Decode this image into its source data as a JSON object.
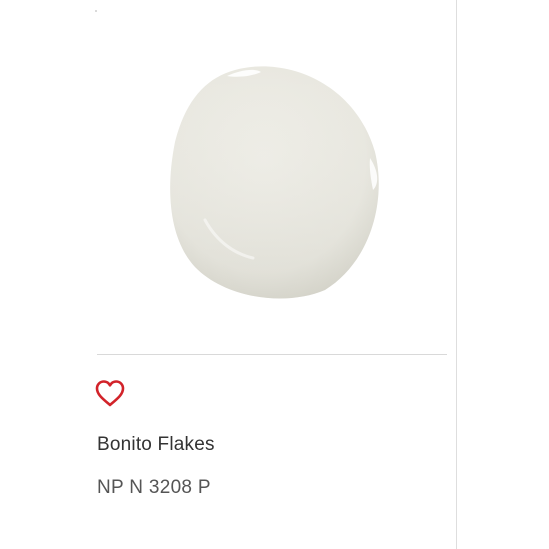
{
  "product": {
    "name": "Bonito Flakes",
    "code": "NP N 3208 P",
    "swatch_color": "#ebeae2"
  },
  "actions": {
    "favorite_icon": "heart-outline-icon",
    "favorite_color": "#d2232a"
  }
}
